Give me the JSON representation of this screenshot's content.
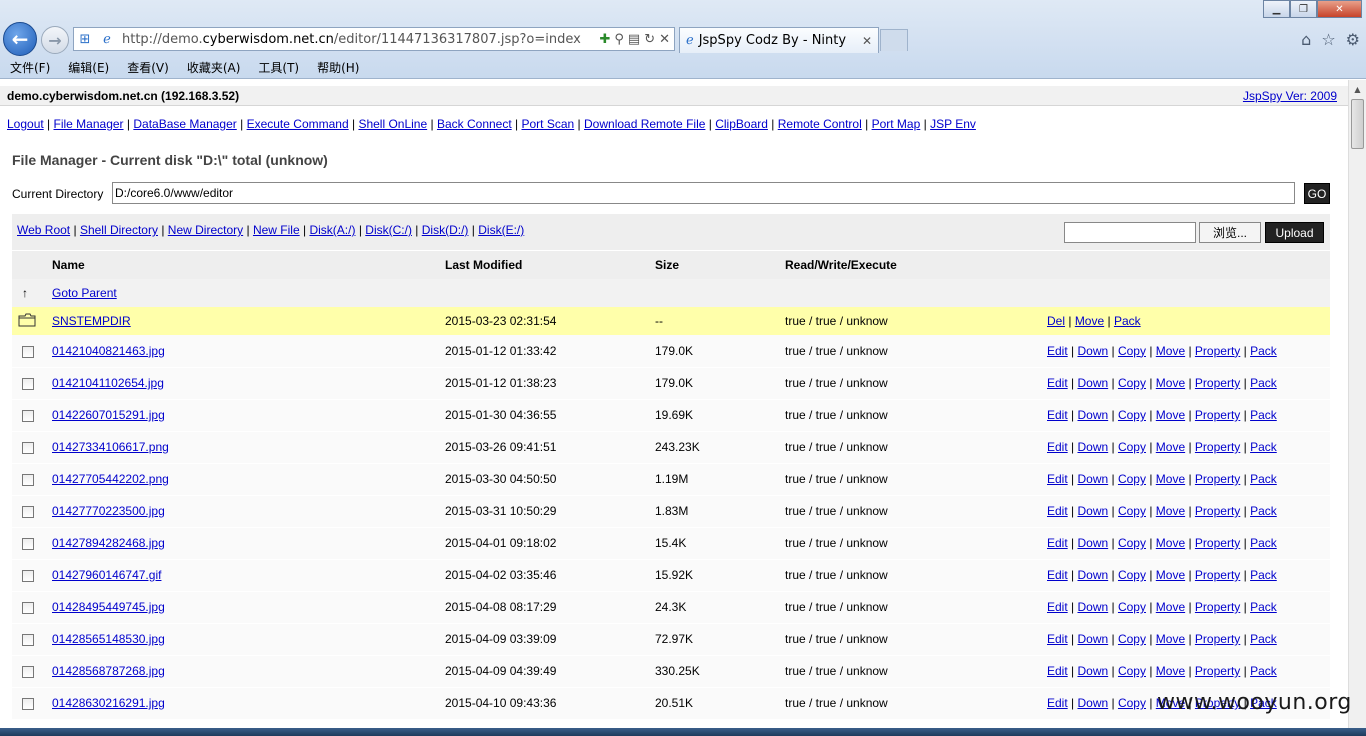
{
  "browser": {
    "url_prefix": "http://demo.",
    "url_host": "cyberwisdom.net.cn",
    "url_suffix": "/editor/11447136317807.jsp?o=index",
    "tab_title": "JspSpy Codz By - Ninty",
    "menu": [
      "文件(F)",
      "编辑(E)",
      "查看(V)",
      "收藏夹(A)",
      "工具(T)",
      "帮助(H)"
    ]
  },
  "header": {
    "host": "demo.cyberwisdom.net.cn (192.168.3.52)",
    "version": "JspSpy Ver: 2009"
  },
  "nav": [
    "Logout",
    "File Manager",
    "DataBase Manager",
    "Execute Command",
    "Shell OnLine",
    "Back Connect",
    "Port Scan",
    "Download Remote File",
    "ClipBoard",
    "Remote Control",
    "Port Map",
    "JSP Env"
  ],
  "file_manager": {
    "title": "File Manager - Current disk \"D:\\\" total (unknow)",
    "current_dir_label": "Current Directory",
    "current_dir_value": "D:/core6.0/www/editor",
    "go_label": "GO",
    "quick_links": [
      "Web Root",
      "Shell Directory",
      "New Directory",
      "New File",
      "Disk(A:/)",
      "Disk(C:/)",
      "Disk(D:/)",
      "Disk(E:/)"
    ],
    "browse_label": "浏览...",
    "upload_label": "Upload",
    "columns": [
      "Name",
      "Last Modified",
      "Size",
      "Read/Write/Execute"
    ],
    "parent_label": "Goto Parent",
    "dir": {
      "name": "SNSTEMPDIR",
      "modified": "2015-03-23 02:31:54",
      "size": "--",
      "rwx": "true / true / unknow",
      "actions": [
        "Del",
        "Move",
        "Pack"
      ]
    },
    "file_actions": [
      "Edit",
      "Down",
      "Copy",
      "Move",
      "Property",
      "Pack"
    ],
    "files": [
      {
        "name": "01421040821463.jpg",
        "modified": "2015-01-12 01:33:42",
        "size": "179.0K",
        "rwx": "true / true / unknow"
      },
      {
        "name": "01421041102654.jpg",
        "modified": "2015-01-12 01:38:23",
        "size": "179.0K",
        "rwx": "true / true / unknow"
      },
      {
        "name": "01422607015291.jpg",
        "modified": "2015-01-30 04:36:55",
        "size": "19.69K",
        "rwx": "true / true / unknow"
      },
      {
        "name": "01427334106617.png",
        "modified": "2015-03-26 09:41:51",
        "size": "243.23K",
        "rwx": "true / true / unknow"
      },
      {
        "name": "01427705442202.png",
        "modified": "2015-03-30 04:50:50",
        "size": "1.19M",
        "rwx": "true / true / unknow"
      },
      {
        "name": "01427770223500.jpg",
        "modified": "2015-03-31 10:50:29",
        "size": "1.83M",
        "rwx": "true / true / unknow"
      },
      {
        "name": "01427894282468.jpg",
        "modified": "2015-04-01 09:18:02",
        "size": "15.4K",
        "rwx": "true / true / unknow"
      },
      {
        "name": "01427960146747.gif",
        "modified": "2015-04-02 03:35:46",
        "size": "15.92K",
        "rwx": "true / true / unknow"
      },
      {
        "name": "01428495449745.jpg",
        "modified": "2015-04-08 08:17:29",
        "size": "24.3K",
        "rwx": "true / true / unknow"
      },
      {
        "name": "01428565148530.jpg",
        "modified": "2015-04-09 03:39:09",
        "size": "72.97K",
        "rwx": "true / true / unknow"
      },
      {
        "name": "01428568787268.jpg",
        "modified": "2015-04-09 04:39:49",
        "size": "330.25K",
        "rwx": "true / true / unknow"
      },
      {
        "name": "01428630216291.jpg",
        "modified": "2015-04-10 09:43:36",
        "size": "20.51K",
        "rwx": "true / true / unknow"
      }
    ]
  },
  "watermark": "www.wooyun.org"
}
